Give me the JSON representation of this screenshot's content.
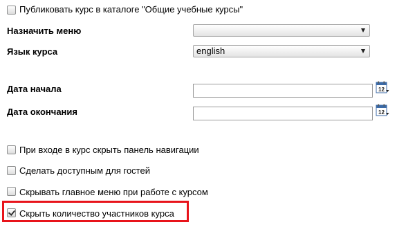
{
  "catalog_checkbox": {
    "label": "Публиковать курс в каталоге \"Общие учебные курсы\"",
    "checked": false
  },
  "menu_field": {
    "label": "Назначить меню",
    "value": ""
  },
  "language_field": {
    "label": "Язык курса",
    "value": "english"
  },
  "start_date": {
    "label": "Дата начала",
    "value": "",
    "calendar_day": "12"
  },
  "end_date": {
    "label": "Дата окончания",
    "value": "",
    "calendar_day": "12"
  },
  "options": [
    {
      "label": "При входе в курс скрыть панель навигации",
      "checked": false
    },
    {
      "label": "Сделать доступным для гостей",
      "checked": false
    },
    {
      "label": "Скрывать главное меню при работе с курсом",
      "checked": false
    },
    {
      "label": "Скрыть количество участников курса",
      "checked": true
    }
  ],
  "highlight_color": "#e8141b"
}
